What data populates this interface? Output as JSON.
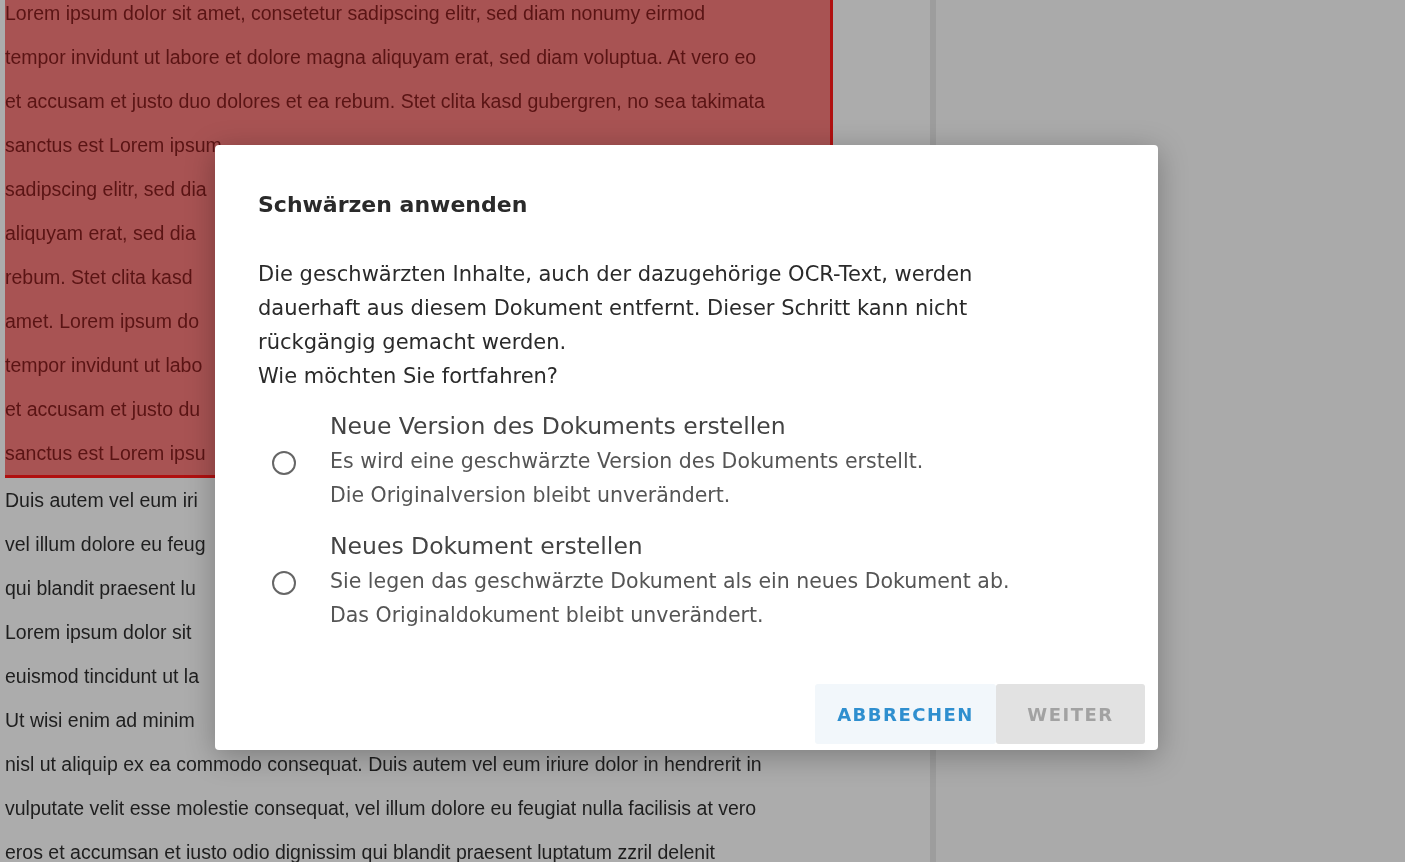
{
  "document": {
    "lines": [
      {
        "text": "Lorem ipsum dolor sit amet, consetetur sadipscing elitr, sed diam nonumy eirmod",
        "redacted": true
      },
      {
        "text": "tempor invidunt ut labore et dolore magna aliquyam erat, sed diam voluptua. At vero eo",
        "redacted": true
      },
      {
        "text": "et accusam et justo duo dolores et ea rebum. Stet clita kasd gubergren, no sea takimata",
        "redacted": true
      },
      {
        "text": "sanctus est Lorem ipsum",
        "redacted": true
      },
      {
        "text": "sadipscing elitr, sed dia",
        "redacted": true
      },
      {
        "text": "aliquyam erat, sed dia",
        "redacted": true
      },
      {
        "text": "rebum. Stet clita kasd",
        "redacted": true
      },
      {
        "text": "amet. Lorem ipsum do",
        "redacted": true
      },
      {
        "text": "tempor invidunt ut labo",
        "redacted": true
      },
      {
        "text": "et accusam et justo du",
        "redacted": true
      },
      {
        "text": "sanctus est Lorem ipsu",
        "redacted": true
      },
      {
        "text": "Duis autem vel eum iri",
        "redacted": false
      },
      {
        "text": "vel illum dolore eu feug",
        "redacted": false
      },
      {
        "text": "qui blandit praesent lu",
        "redacted": false
      },
      {
        "text": "Lorem ipsum dolor sit",
        "redacted": false
      },
      {
        "text": "euismod tincidunt ut la",
        "redacted": false
      },
      {
        "text": "Ut wisi enim ad minim",
        "redacted": false
      },
      {
        "text": "nisl ut aliquip ex ea commodo consequat. Duis autem vel eum iriure dolor in hendrerit in",
        "redacted": false
      },
      {
        "text": "vulputate velit esse molestie consequat, vel illum dolore eu feugiat nulla facilisis at vero",
        "redacted": false
      },
      {
        "text": "eros et accumsan et iusto odio dignissim qui blandit praesent luptatum zzril delenit",
        "redacted": false
      }
    ]
  },
  "dialog": {
    "title": "Schwärzen anwenden",
    "message": [
      "Die geschwärzten Inhalte, auch der dazugehörige OCR-Text, werden dauerhaft aus diesem Dokument entfernt. Dieser Schritt kann nicht rückgängig gemacht werden.",
      "Wie möchten Sie fortfahren?"
    ],
    "options": [
      {
        "label": "Neue Version des Dokuments erstellen",
        "description": [
          "Es wird eine geschwärzte Version des Dokuments erstellt.",
          "Die Originalversion bleibt unverändert."
        ],
        "selected": false
      },
      {
        "label": "Neues Dokument erstellen",
        "description": [
          "Sie legen das geschwärzte Dokument als ein neues Dokument ab.",
          "Das Originaldokument bleibt unverändert."
        ],
        "selected": false
      }
    ],
    "buttons": [
      {
        "label": "ABBRECHEN",
        "kind": "text",
        "disabled": false
      },
      {
        "label": "WEITER",
        "kind": "filled",
        "disabled": true
      }
    ]
  }
}
